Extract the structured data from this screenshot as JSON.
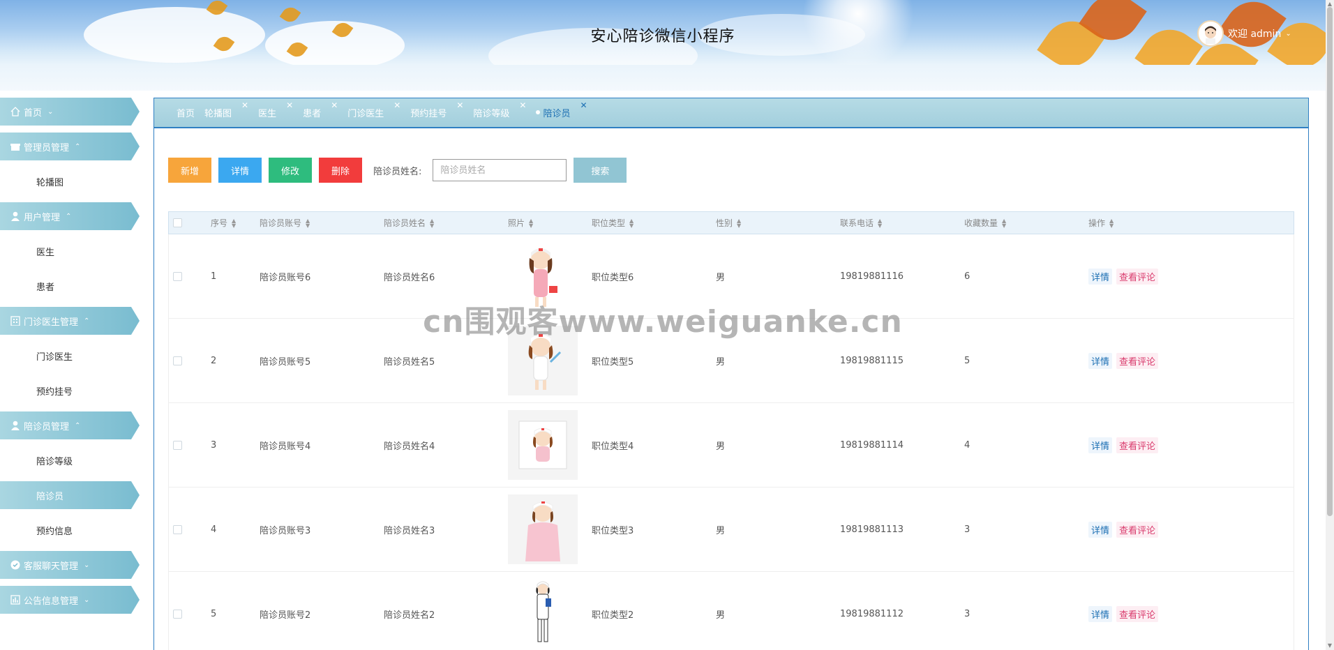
{
  "header": {
    "title": "安心陪诊微信小程序",
    "welcome": "欢迎 admin"
  },
  "sidebar": {
    "groups": [
      {
        "label": "首页",
        "icon": "home-icon"
      },
      {
        "label": "管理员管理",
        "icon": "gift-icon",
        "items": [
          "轮播图"
        ]
      },
      {
        "label": "用户管理",
        "icon": "user-icon",
        "items": [
          "医生",
          "患者"
        ]
      },
      {
        "label": "门诊医生管理",
        "icon": "building-icon",
        "items": [
          "门诊医生",
          "预约挂号"
        ]
      },
      {
        "label": "陪诊员管理",
        "icon": "user-icon",
        "items": [
          "陪诊等级",
          "陪诊员",
          "预约信息"
        ]
      },
      {
        "label": "客服聊天管理",
        "icon": "check-circle-icon"
      },
      {
        "label": "公告信息管理",
        "icon": "chart-icon"
      }
    ],
    "active_item": "陪诊员"
  },
  "tabs": [
    "首页",
    "轮播图",
    "医生",
    "患者",
    "门诊医生",
    "预约挂号",
    "陪诊等级",
    "陪诊员"
  ],
  "toolbar": {
    "add": "新增",
    "detail": "详情",
    "edit": "修改",
    "delete": "删除",
    "search_label": "陪诊员姓名:",
    "search_placeholder": "陪诊员姓名",
    "search_button": "搜索"
  },
  "table": {
    "headers": [
      "序号",
      "陪诊员账号",
      "陪诊员姓名",
      "照片",
      "职位类型",
      "性别",
      "联系电话",
      "收藏数量",
      "操作"
    ],
    "rows": [
      {
        "no": "1",
        "account": "陪诊员账号6",
        "name": "陪诊员姓名6",
        "type": "职位类型6",
        "gender": "男",
        "phone": "19819881116",
        "fav": "6"
      },
      {
        "no": "2",
        "account": "陪诊员账号5",
        "name": "陪诊员姓名5",
        "type": "职位类型5",
        "gender": "男",
        "phone": "19819881115",
        "fav": "5"
      },
      {
        "no": "3",
        "account": "陪诊员账号4",
        "name": "陪诊员姓名4",
        "type": "职位类型4",
        "gender": "男",
        "phone": "19819881114",
        "fav": "4"
      },
      {
        "no": "4",
        "account": "陪诊员账号3",
        "name": "陪诊员姓名3",
        "type": "职位类型3",
        "gender": "男",
        "phone": "19819881113",
        "fav": "3"
      },
      {
        "no": "5",
        "account": "陪诊员账号2",
        "name": "陪诊员姓名2",
        "type": "职位类型2",
        "gender": "男",
        "phone": "19819881112",
        "fav": "3"
      }
    ],
    "op_view": "详情",
    "op_comment": "查看评论"
  },
  "watermark": "cn围观客www.weiguanke.cn",
  "colors": {
    "accent": "#79bcd0",
    "border_blue": "#2f7fc3",
    "btn_add": "#f7a53b",
    "btn_detail": "#3ba8f0",
    "btn_edit": "#2ebc7e",
    "btn_delete": "#f23c3c",
    "btn_search": "#91c5d3"
  }
}
